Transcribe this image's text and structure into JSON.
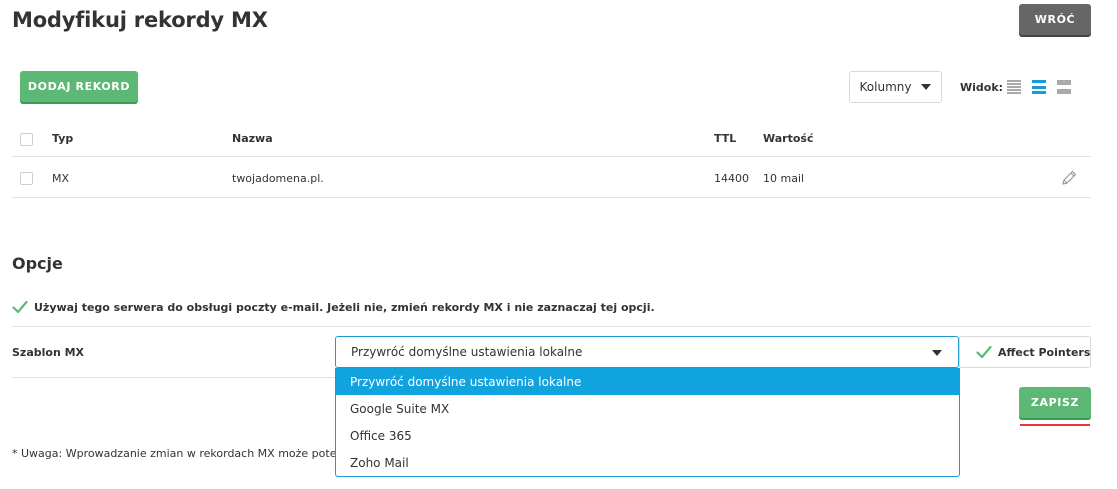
{
  "header": {
    "title": "Modyfikuj rekordy MX",
    "back_label": "WRÓĆ"
  },
  "toolbar": {
    "add_label": "DODAJ REKORD",
    "columns_label": "Kolumny",
    "view_label": "Widok:",
    "view_selected": "medium"
  },
  "table": {
    "columns": [
      "Typ",
      "Nazwa",
      "TTL",
      "Wartość"
    ],
    "rows": [
      {
        "type": "MX",
        "name": "twojadomena.pl.",
        "ttl": "14400",
        "value": "10 mail"
      }
    ]
  },
  "options": {
    "title": "Opcje",
    "use_server_text": "Używaj tego serwera do obsługi poczty e-mail. Jeżeli nie, zmień rekordy MX i nie zaznaczaj tej opcji.",
    "use_server_checked": true,
    "template_label": "Szablon MX",
    "template_selected": "Przywróć domyślne ustawienia lokalne",
    "template_options": [
      "Przywróć domyślne ustawienia lokalne",
      "Google Suite MX",
      "Office 365",
      "Zoho Mail"
    ],
    "affect_pointers_label": "Affect Pointers",
    "affect_pointers_checked": true,
    "save_label": "ZAPISZ"
  },
  "note": "* Uwaga: Wprowadzanie zmian w rekordach MX może potencjalnie",
  "colors": {
    "accent_green": "#5cb874",
    "accent_blue": "#1a9bd7",
    "highlight_red": "#e53935",
    "dark_button": "#666666"
  }
}
